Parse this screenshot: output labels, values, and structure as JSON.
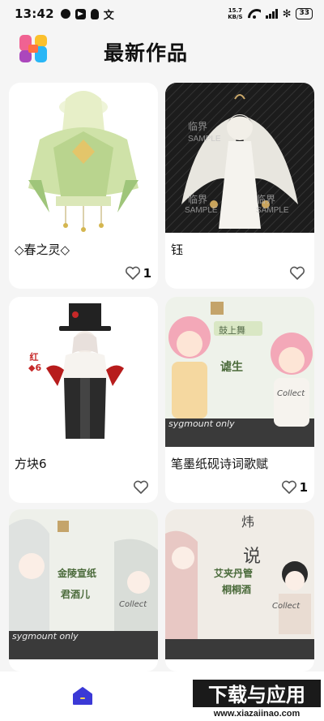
{
  "status_bar": {
    "time": "13:42",
    "wen": "文",
    "net_speed_value": "15.7",
    "net_speed_unit": "KB/S",
    "bt": "✻",
    "battery": "33"
  },
  "header": {
    "title": "最新作品"
  },
  "cards": [
    {
      "title": "◇春之灵◇",
      "likes": "1",
      "liked": false
    },
    {
      "title": "钰",
      "likes": "",
      "liked": false
    },
    {
      "title": "方块6",
      "likes": "",
      "liked": false
    },
    {
      "title": "笔墨纸砚诗词歌赋",
      "likes": "1",
      "liked": false
    },
    {
      "title": "",
      "likes": "",
      "liked": false
    },
    {
      "title": "",
      "likes": "",
      "liked": false
    }
  ],
  "artwork_text": {
    "card2_sample_1": "临界",
    "card2_sample_2": "SAMPLE",
    "card3_side": "红◆6",
    "card4_seal": "鼓上舞",
    "card4_name": "谑生",
    "card4_cursive": "Collect",
    "card4_footer": "sygmount only",
    "card5_seal": "金陵宣纸",
    "card5_name": "君酒儿",
    "card5_cursive": "Collect",
    "card5_footer": "sygmount only",
    "card6_top": "炜",
    "card6_shuo": "说",
    "card6_name": "艾夹丹管",
    "card6_sub": "桐桐酒",
    "card6_cursive": "Collect"
  },
  "bottom_nav": {
    "home_icon": "home-icon",
    "watermark_cn": "下载与应用",
    "watermark_url": "www.xiazaiinao.com"
  },
  "colors": {
    "background": "#f5f5f5",
    "card": "#ffffff",
    "accent": "#3b39d6"
  }
}
